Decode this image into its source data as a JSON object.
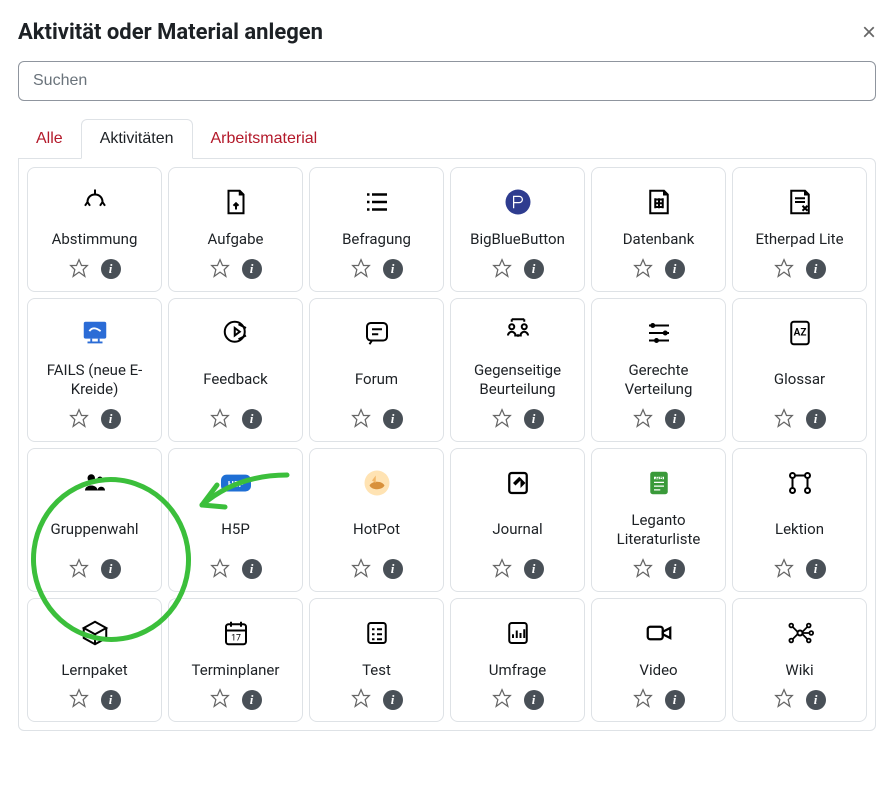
{
  "header": {
    "title": "Aktivität oder Material anlegen"
  },
  "search": {
    "placeholder": "Suchen"
  },
  "tabs": {
    "all": "Alle",
    "activities": "Aktivitäten",
    "resources": "Arbeitsmaterial",
    "active": "activities"
  },
  "items": [
    {
      "label": "Abstimmung",
      "icon": "choice"
    },
    {
      "label": "Aufgabe",
      "icon": "assign"
    },
    {
      "label": "Befragung",
      "icon": "question"
    },
    {
      "label": "BigBlueButton",
      "icon": "bbb"
    },
    {
      "label": "Datenbank",
      "icon": "database"
    },
    {
      "label": "Etherpad Lite",
      "icon": "etherpad"
    },
    {
      "label": "FAILS (neue E-Kreide)",
      "icon": "fails"
    },
    {
      "label": "Feedback",
      "icon": "feedback"
    },
    {
      "label": "Forum",
      "icon": "forum"
    },
    {
      "label": "Gegenseitige Beurteilung",
      "icon": "workshop"
    },
    {
      "label": "Gerechte Verteilung",
      "icon": "ratingalloc"
    },
    {
      "label": "Glossar",
      "icon": "glossary"
    },
    {
      "label": "Gruppenwahl",
      "icon": "group"
    },
    {
      "label": "H5P",
      "icon": "h5p"
    },
    {
      "label": "HotPot",
      "icon": "hotpot"
    },
    {
      "label": "Journal",
      "icon": "journal"
    },
    {
      "label": "Leganto Literaturliste",
      "icon": "leganto"
    },
    {
      "label": "Lektion",
      "icon": "lesson"
    },
    {
      "label": "Lernpaket",
      "icon": "scorm"
    },
    {
      "label": "Terminplaner",
      "icon": "scheduler"
    },
    {
      "label": "Test",
      "icon": "quiz"
    },
    {
      "label": "Umfrage",
      "icon": "survey"
    },
    {
      "label": "Video",
      "icon": "video"
    },
    {
      "label": "Wiki",
      "icon": "wiki"
    }
  ]
}
